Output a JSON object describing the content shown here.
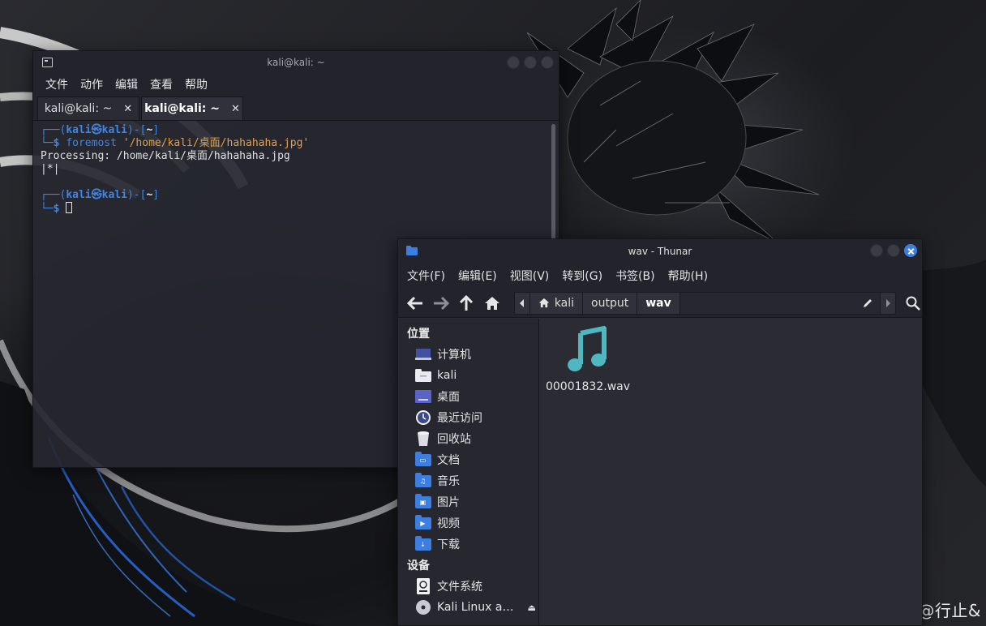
{
  "watermark": "CSDN @行止&",
  "terminal": {
    "title": "kali@kali: ~",
    "menu": [
      "文件",
      "动作",
      "编辑",
      "查看",
      "帮助"
    ],
    "tabs": [
      {
        "label": "kali@kali: ~",
        "close": "✕",
        "active": false
      },
      {
        "label": "kali@kali: ~",
        "close": "✕",
        "active": true
      }
    ],
    "prompt1": {
      "open": "┌──(",
      "user": "kali",
      "at": "㉿",
      "host": "kali",
      "mid": ")-[",
      "path": "~",
      "close": "]"
    },
    "line2": {
      "prefix": "└─",
      "dollar": "$ ",
      "cmd": "foremost",
      "arg": "'/home/kali/桌面/hahahaha.jpg'"
    },
    "output1": "Processing: /home/kali/桌面/hahahaha.jpg",
    "output2": "|*|",
    "prompt2": {
      "open": "┌──(",
      "user": "kali",
      "at": "㉿",
      "host": "kali",
      "mid": ")-[",
      "path": "~",
      "close": "]"
    },
    "line4": {
      "prefix": "└─",
      "dollar": "$ "
    }
  },
  "thunar": {
    "title": "wav - Thunar",
    "menu": [
      "文件(F)",
      "编辑(E)",
      "视图(V)",
      "转到(G)",
      "书签(B)",
      "帮助(H)"
    ],
    "path": [
      "kali",
      "output",
      "wav"
    ],
    "sidebar": {
      "places_heading": "位置",
      "places": [
        "计算机",
        "kali",
        "桌面",
        "最近访问",
        "回收站",
        "文档",
        "音乐",
        "图片",
        "视频",
        "下载"
      ],
      "devices_heading": "设备",
      "devices": [
        "文件系统",
        "Kali Linux a…"
      ]
    },
    "files": [
      {
        "name": "00001832.wav",
        "icon": "music-note-icon"
      }
    ],
    "colors": {
      "accent": "#3d7fe0",
      "audio_icon": "#4fb7c0"
    }
  }
}
